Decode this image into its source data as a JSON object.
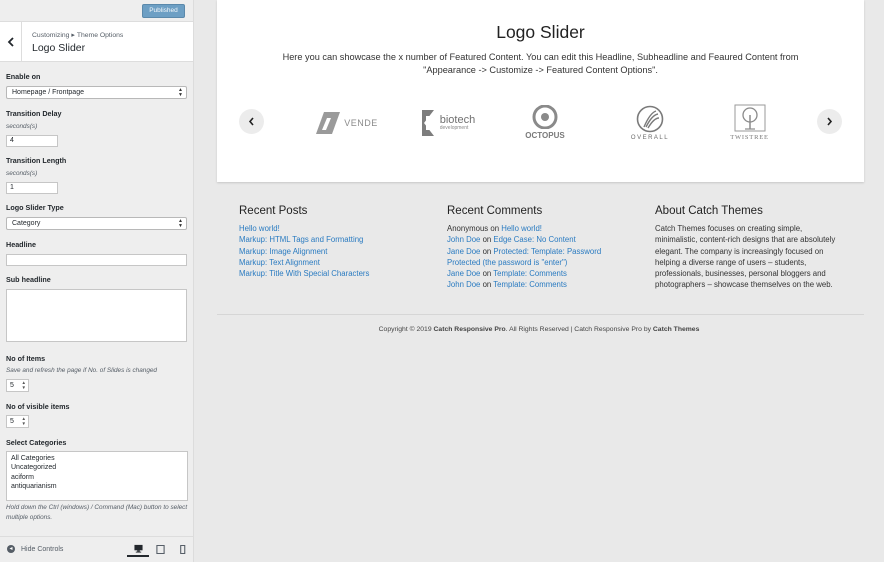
{
  "sidebar": {
    "publish_label": "Published",
    "breadcrumb": {
      "root": "Customizing",
      "separator": "▸",
      "parent": "Theme Options"
    },
    "section_title": "Logo Slider",
    "enable_on": {
      "label": "Enable on",
      "value": "Homepage / Frontpage"
    },
    "transition_delay": {
      "label": "Transition Delay",
      "unit": "seconds(s)",
      "value": "4"
    },
    "transition_length": {
      "label": "Transition Length",
      "unit": "seconds(s)",
      "value": "1"
    },
    "slider_type": {
      "label": "Logo Slider Type",
      "value": "Category"
    },
    "headline": {
      "label": "Headline",
      "value": ""
    },
    "sub_headline": {
      "label": "Sub headline",
      "value": ""
    },
    "no_of_items": {
      "label": "No of Items",
      "note": "Save and refresh the page if No. of Slides is changed",
      "value": "5"
    },
    "visible_items": {
      "label": "No of visible items",
      "value": "5"
    },
    "categories": {
      "label": "Select Categories",
      "options": [
        "All Categories",
        "Uncategorized",
        "aciform",
        "antiquarianism"
      ],
      "help": "Hold down the Ctrl (windows) / Command (Mac) button to select multiple options."
    },
    "footer": {
      "hide_controls_label": "Hide Controls",
      "hide_icon": "arrow-left-circle-icon",
      "devices": [
        "desktop-icon",
        "tablet-icon",
        "mobile-icon"
      ]
    }
  },
  "preview": {
    "slider": {
      "title": "Logo Slider",
      "description_line1": "Here you can showcase the x number of Featured Content. You can edit this Headline, Subheadline and Feaured Content from",
      "description_line2": "\"Appearance -> Customize -> Featured Content Options\".",
      "logos": [
        {
          "name": "VENDE",
          "sub": ""
        },
        {
          "name": "biotech",
          "sub": "development"
        },
        {
          "name": "OCTOPUS",
          "sub": ""
        },
        {
          "name": "OVERALL",
          "sub": ""
        },
        {
          "name": "TWISTREE",
          "sub": ""
        }
      ]
    },
    "recent_posts": {
      "title": "Recent Posts",
      "items": [
        "Hello world!",
        "Markup: HTML Tags and Formatting",
        "Markup: Image Alignment",
        "Markup: Text Alignment",
        "Markup: Title With Special Characters"
      ]
    },
    "recent_comments": {
      "title": "Recent Comments",
      "connector": "on",
      "items": [
        {
          "author": "Anonymous",
          "post": "Hello world!"
        },
        {
          "author": "John Doe",
          "post": "Edge Case: No Content"
        },
        {
          "author": "Jane Doe",
          "post": "Protected: Template: Password"
        },
        {
          "author": "",
          "post": "Protected (the password is \"enter\")"
        },
        {
          "author": "Jane Doe",
          "post": "Template: Comments"
        },
        {
          "author": "John Doe",
          "post": "Template: Comments"
        }
      ]
    },
    "about": {
      "title": "About Catch Themes",
      "text": "Catch Themes focuses on creating simple, minimalistic, content-rich designs that are absolutely elegant. The company is increasingly focused on helping a diverse range of users – students, professionals, businesses, personal bloggers and photographers – showcase themselves on the web."
    },
    "copyright": {
      "prefix": "Copyright © 2019 ",
      "site": "Catch Responsive Pro",
      "middle": ". All Rights Reserved | Catch Responsive Pro by ",
      "author": "Catch Themes"
    }
  },
  "colors": {
    "link": "#2a7bc1",
    "publish_button": "#6d9fc4"
  }
}
